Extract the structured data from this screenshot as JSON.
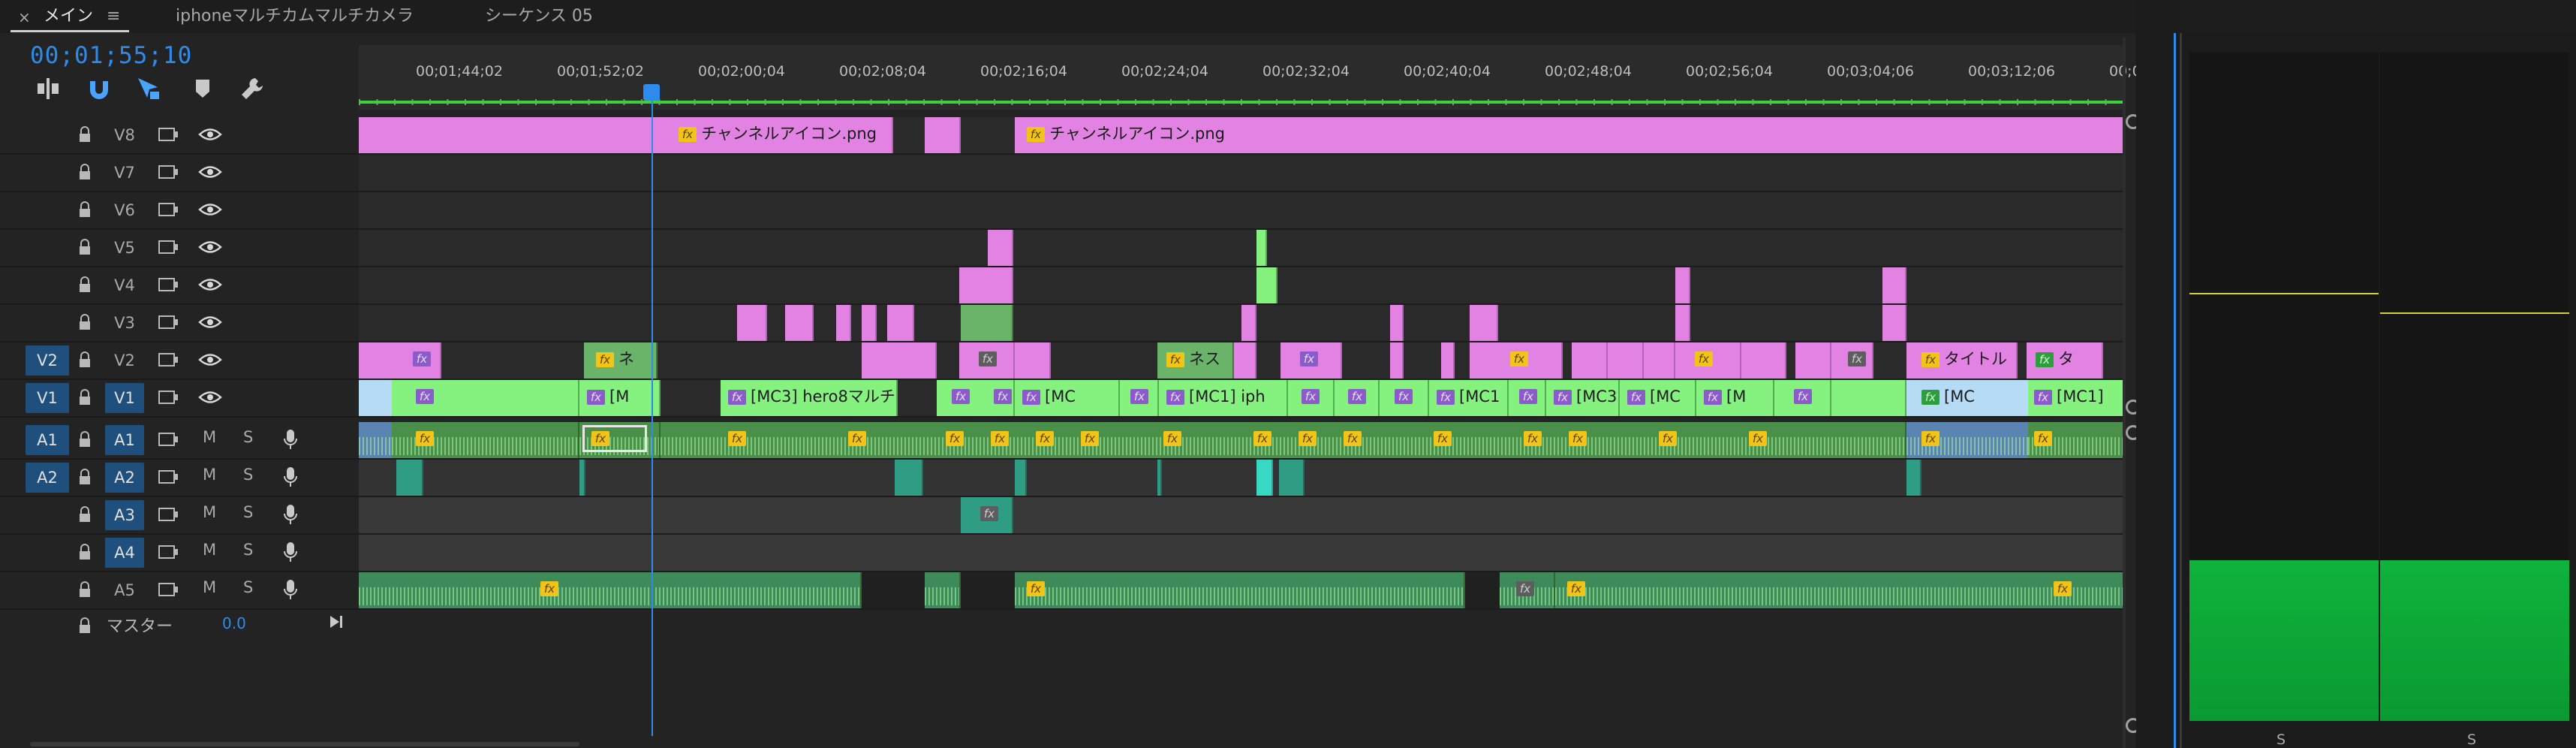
{
  "tabs": [
    {
      "label": "メイン",
      "active": true
    },
    {
      "label": "iphoneマルチカムマルチカメラ",
      "active": false
    },
    {
      "label": "シーケンス 05",
      "active": false
    }
  ],
  "tab_close_glyph": "×",
  "tab_menu_glyph": "≡",
  "timecode": "00;01;55;10",
  "tools": [
    "insert-track-icon",
    "snap-magnet-icon",
    "linked-selection-icon",
    "add-marker-icon",
    "wrench-settings-icon"
  ],
  "ruler_labels": [
    "00;01;44;02",
    "00;01;52;02",
    "00;02;00;04",
    "00;02;08;04",
    "00;02;16;04",
    "00;02;24;04",
    "00;02;32;04",
    "00;02;40;04",
    "00;02;48;04",
    "00;02;56;04",
    "00;03;04;06",
    "00;03;12;06",
    "00;0"
  ],
  "video_tracks": [
    {
      "name": "V8"
    },
    {
      "name": "V7"
    },
    {
      "name": "V6"
    },
    {
      "name": "V5"
    },
    {
      "name": "V4"
    },
    {
      "name": "V3"
    },
    {
      "name": "V2",
      "source": "V2"
    },
    {
      "name": "V1",
      "source": "V1",
      "patched": true
    }
  ],
  "audio_tracks": [
    {
      "name": "A1",
      "source": "A1",
      "m": "M",
      "s": "S"
    },
    {
      "name": "A2",
      "source": "A2",
      "m": "M",
      "s": "S"
    },
    {
      "name": "A3",
      "m": "M",
      "s": "S"
    },
    {
      "name": "A4",
      "m": "M",
      "s": "S"
    },
    {
      "name": "A5",
      "m": "M",
      "s": "S"
    }
  ],
  "master": {
    "label": "マスター",
    "value": "0.0"
  },
  "clip_labels": {
    "v8_clip_1": "チャンネルアイコン.png",
    "v8_clip_2": "チャンネルアイコン.png",
    "v2_ne": "ネ",
    "v2_nesu": "ネス",
    "v2_title": "タイトル",
    "v2_ta": "タ",
    "v1_m": "[M",
    "v1_mc3_hero8": "[MC3] hero8マルチ",
    "v1_mc_a": "[MC",
    "v1_mc1_iph": "[MC1] iph",
    "v1_mc1": "[MC1",
    "v1_mc3": "[MC3",
    "v1_mc_b": "[MC",
    "v1_m_b": "[M",
    "v1_mc_c": "[MC",
    "v1_mc1_end": "[MC1]"
  },
  "fx_label": "fx",
  "meter": {
    "left_label": "S",
    "right_label": "S",
    "left_level": 0.24,
    "right_level": 0.24
  },
  "colors": {
    "accent": "#2d8ceb",
    "video_pink": "#e283e4",
    "video_green": "#85f27f",
    "audio_green": "#4a8f4a",
    "audio_teal": "#2f9d84"
  }
}
